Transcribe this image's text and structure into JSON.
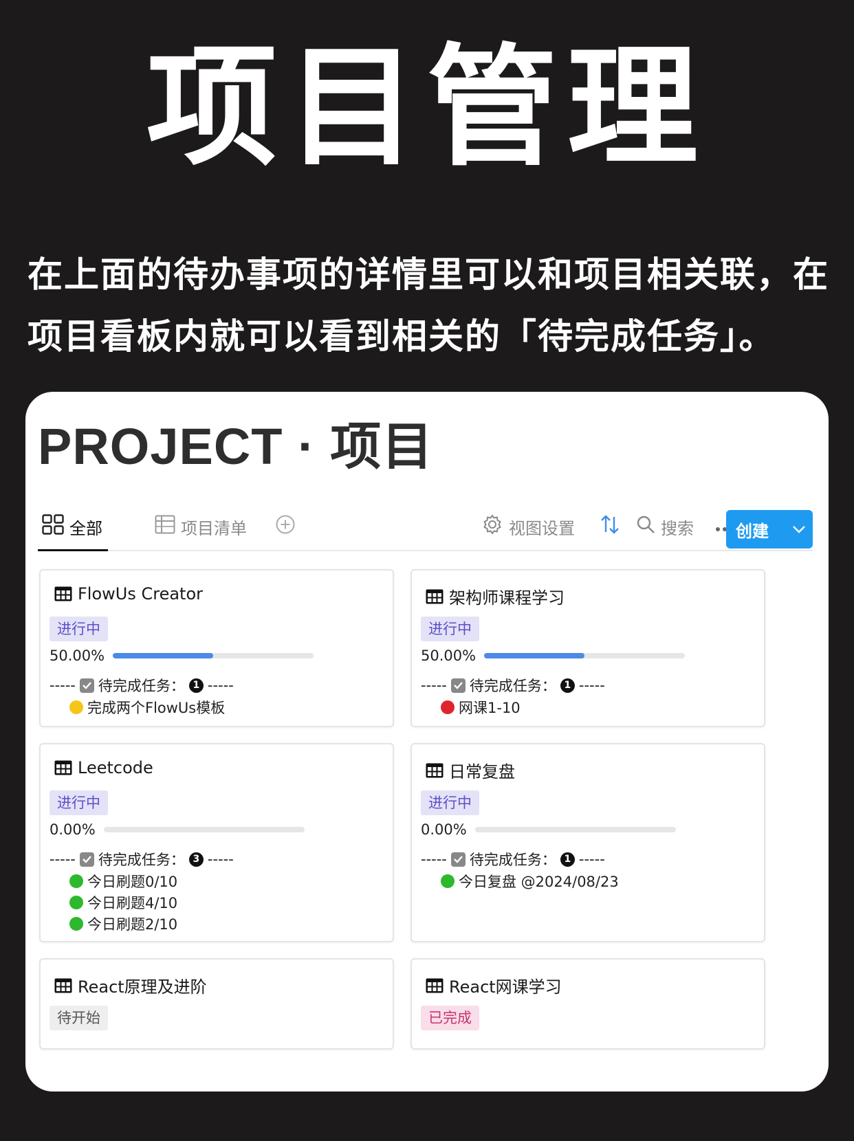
{
  "hero": {
    "title": "项目管理",
    "description": "在上面的待办事项的详情里可以和项目相关联，在项目看板内就可以看到相关的「待完成任务」。"
  },
  "panel": {
    "title": "PROJECT · 项目"
  },
  "toolbar": {
    "tabs": [
      {
        "label": "全部",
        "icon": "grid-icon",
        "active": true
      },
      {
        "label": "项目清单",
        "icon": "table-icon",
        "active": false
      }
    ],
    "add_icon": "plus-circle-icon",
    "view_settings_label": "视图设置",
    "sort_icon": "sort-arrows-icon",
    "search_label": "搜索",
    "more_icon": "more-icon",
    "create_label": "创建",
    "accent_color": "#1e9bf0"
  },
  "todo_label": "待完成任务：",
  "cards": [
    {
      "title": "FlowUs Creator",
      "status": "进行中",
      "status_style": "progress",
      "progress_text": "50.00%",
      "progress": 0.5,
      "todo_count": "1",
      "todos": [
        {
          "text": "完成两个FlowUs模板",
          "color": "yellow"
        }
      ]
    },
    {
      "title": "架构师课程学习",
      "status": "进行中",
      "status_style": "progress",
      "progress_text": "50.00%",
      "progress": 0.5,
      "todo_count": "1",
      "todos": [
        {
          "text": "网课1-10",
          "color": "red"
        }
      ]
    },
    {
      "title": "Leetcode",
      "status": "进行中",
      "status_style": "progress",
      "progress_text": "0.00%",
      "progress": 0,
      "todo_count": "3",
      "todos": [
        {
          "text": "今日刷题0/10",
          "color": "green"
        },
        {
          "text": "今日刷题4/10",
          "color": "green"
        },
        {
          "text": "今日刷题2/10",
          "color": "green"
        }
      ]
    },
    {
      "title": "日常复盘",
      "status": "进行中",
      "status_style": "progress",
      "progress_text": "0.00%",
      "progress": 0,
      "todo_count": "1",
      "todos": [
        {
          "text": "今日复盘 @2024/08/23",
          "color": "green"
        }
      ]
    },
    {
      "title": "React原理及进阶",
      "status": "待开始",
      "status_style": "pending"
    },
    {
      "title": "React网课学习",
      "status": "已完成",
      "status_style": "done"
    }
  ],
  "colors": {
    "status_progress_bg": "#e4e2f7",
    "status_progress_fg": "#5b50c7",
    "status_pending_bg": "#eeeeee",
    "status_pending_fg": "#555555",
    "status_done_bg": "#f9dde9",
    "status_done_fg": "#c2366e",
    "progress_fill": "#4d8ae6",
    "dot_yellow": "#f5c518",
    "dot_red": "#e0242e",
    "dot_green": "#2db82d"
  }
}
